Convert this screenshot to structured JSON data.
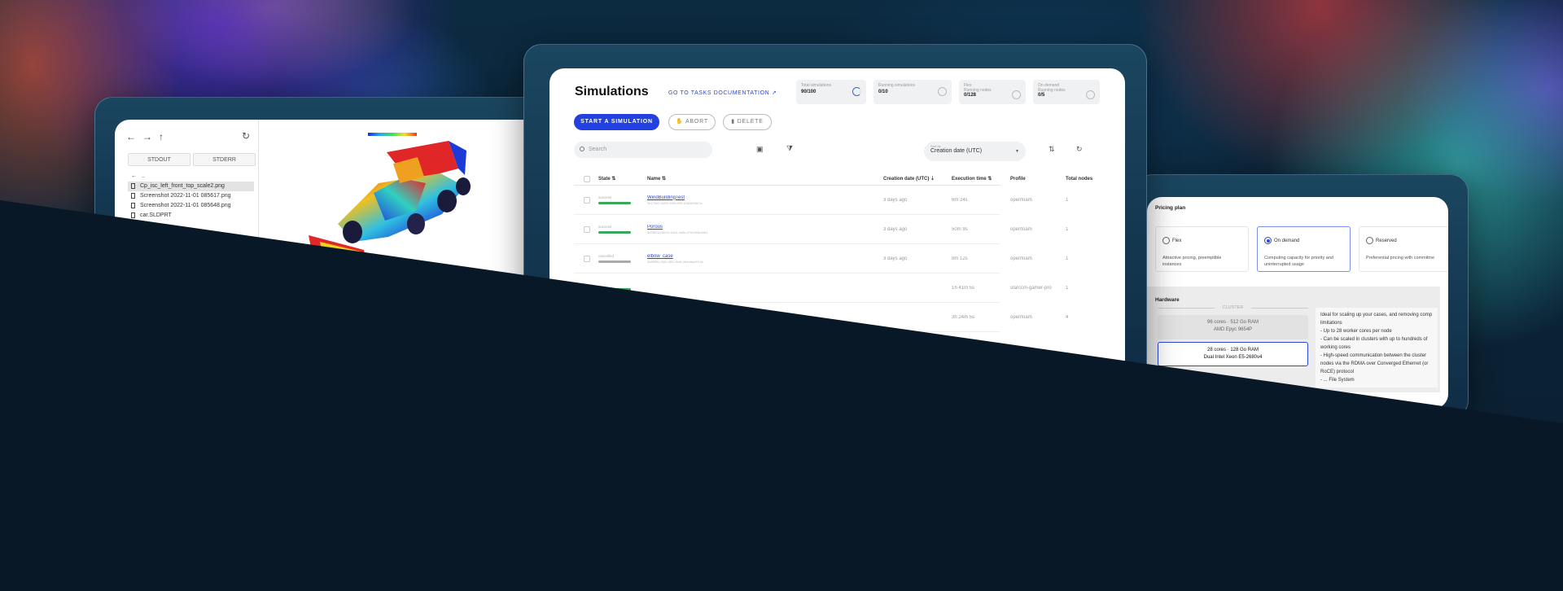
{
  "file_browser": {
    "tabs": [
      "STDOUT",
      "STDERR"
    ],
    "parent_entry": "..",
    "files": [
      {
        "name": "Cp_isc_left_front_top_scale2.png",
        "selected": true
      },
      {
        "name": "Screenshot 2022-11-01 085617.png",
        "selected": false
      },
      {
        "name": "Screenshot 2022-11-01 085648.png",
        "selected": false
      },
      {
        "name": "car.SLDPRT",
        "selected": false
      }
    ],
    "viewer_legend": "Pressure"
  },
  "simulations": {
    "title": "Simulations",
    "doc_link": "GO TO TASKS DOCUMENTATION ↗",
    "stats": [
      {
        "label": "Total simulations",
        "value": "90/100"
      },
      {
        "label": "Running simulations",
        "value": "0/10"
      },
      {
        "label": "Flex",
        "sub": "Running nodes",
        "value": "0/128"
      },
      {
        "label": "On demand",
        "sub": "Running nodes",
        "value": "0/5"
      }
    ],
    "start_button": "START A SIMULATION",
    "abort_button": "ABORT",
    "delete_button": "DELETE",
    "search_placeholder": "Search",
    "sort_label": "Sort by",
    "sort_value": "Creation date (UTC)",
    "columns": {
      "state": "State",
      "name": "Name",
      "created": "Creation date (UTC)",
      "exec": "Execution time",
      "profile": "Profile",
      "nodes": "Total nodes"
    },
    "rows": [
      {
        "state": "success",
        "state_color": "#3aa65a",
        "name": "WindBuildingTest",
        "id": "3e17bb0-3d50-48f0-8f5f-1f3d3836b7a",
        "created": "3 days ago",
        "exec": "6m 24s",
        "profile": "openfoam",
        "nodes": "1"
      },
      {
        "state": "success",
        "state_color": "#3aa65a",
        "name": "Porous",
        "id": "9ef3b41a-8b03-4810-9a5b-e7b02f3ba9b3",
        "created": "3 days ago",
        "exec": "50m 9s",
        "profile": "openfoam",
        "nodes": "1"
      },
      {
        "state": "cancelled",
        "state_color": "#aaaaaa",
        "name": "elbow_case",
        "id": "4b6f9f6c-9f2e-4f52-8c8f-3b4a8ac5f19c",
        "created": "3 days ago",
        "exec": "8m 12s",
        "profile": "openfoam",
        "nodes": "1"
      },
      {
        "state": "",
        "state_color": "#3aa65a",
        "name": "",
        "id": "",
        "created": "",
        "exec": "1h 41m 5s",
        "profile": "starccm-gamer-pro",
        "nodes": "1"
      },
      {
        "state": "",
        "state_color": "#3aa65a",
        "name": "",
        "id": "",
        "created": "",
        "exec": "3h 24m 5s",
        "profile": "openfoam",
        "nodes": "4"
      }
    ]
  },
  "pricing": {
    "title": "Pricing plan",
    "plans": [
      {
        "name": "Flex",
        "desc": "Attractive pricing, preemptible instances",
        "selected": false
      },
      {
        "name": "On demand",
        "desc": "Computing capacity for priority and uninterrupted usage",
        "selected": true
      },
      {
        "name": "Reserved",
        "desc": "Preferential pricing with commitme",
        "selected": false
      }
    ],
    "hardware_title": "Hardware",
    "cluster_label": "CLUSTER",
    "cards": [
      {
        "line1": "96 cores · 512 Go RAM",
        "line2": "AMD Epyc 9654P",
        "selected": false
      },
      {
        "line1": "28 cores · 128 Go RAM",
        "line2": "Dual Intel Xeon E5-2680v4",
        "selected": true
      }
    ],
    "description": "Ideal for scaling up your cases, and removing comp limitations\n- Up to 28 worker cores per node\n- Can be scaled in clusters with up to hundreds of working cores\n- High-speed communication between the cluster nodes via the RDMA over Converged Ethernet (or RoCE) protocol\n- ... File System"
  }
}
